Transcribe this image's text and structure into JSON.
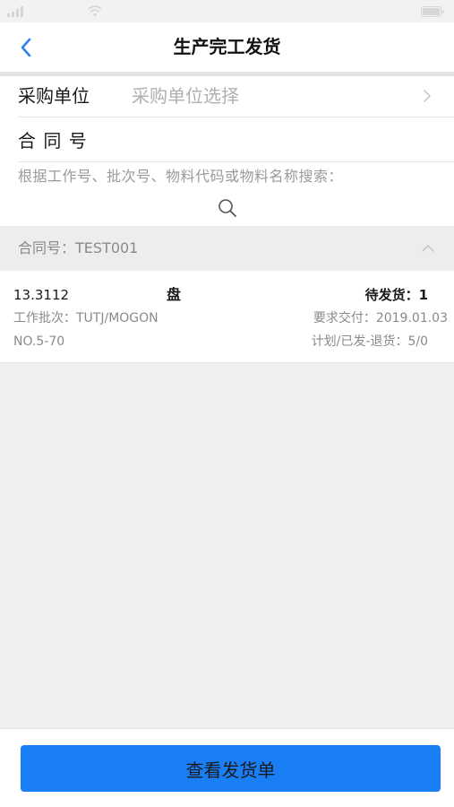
{
  "status_bar": {
    "icons": [
      "signal-icon",
      "wifi-icon",
      "battery-icon"
    ]
  },
  "nav": {
    "title": "生产完工发货",
    "back_icon": "chevron-left-icon"
  },
  "form": {
    "purchase_unit": {
      "label": "采购单位",
      "placeholder": "采购单位选择",
      "icon": "chevron-right-icon"
    },
    "contract_no": {
      "label": "合 同 号"
    },
    "search": {
      "hint": "根据工作号、批次号、物料代码或物料名称搜索：",
      "icon": "search-icon"
    }
  },
  "groups": [
    {
      "header": "合同号：TEST001",
      "icon": "chevron-up-icon",
      "items": [
        {
          "code": "13.3112",
          "unit": "盘",
          "pending": "待发货：1",
          "batch": "工作批次：TUTJ/MOGON",
          "due_date": "要求交付：2019.01.03",
          "number": "NO.5-70",
          "plan_shipped_returned": "计划/已发-退货：5/0"
        }
      ]
    }
  ],
  "footer": {
    "button_label": "查看发货单"
  },
  "colors": {
    "accent": "#1a7ef5",
    "back_icon": "#2f80f0",
    "text_primary": "#1e1e1e",
    "text_secondary": "#8a8a8a",
    "placeholder": "#b0b0b0",
    "page_bg": "#f0f0f2"
  }
}
